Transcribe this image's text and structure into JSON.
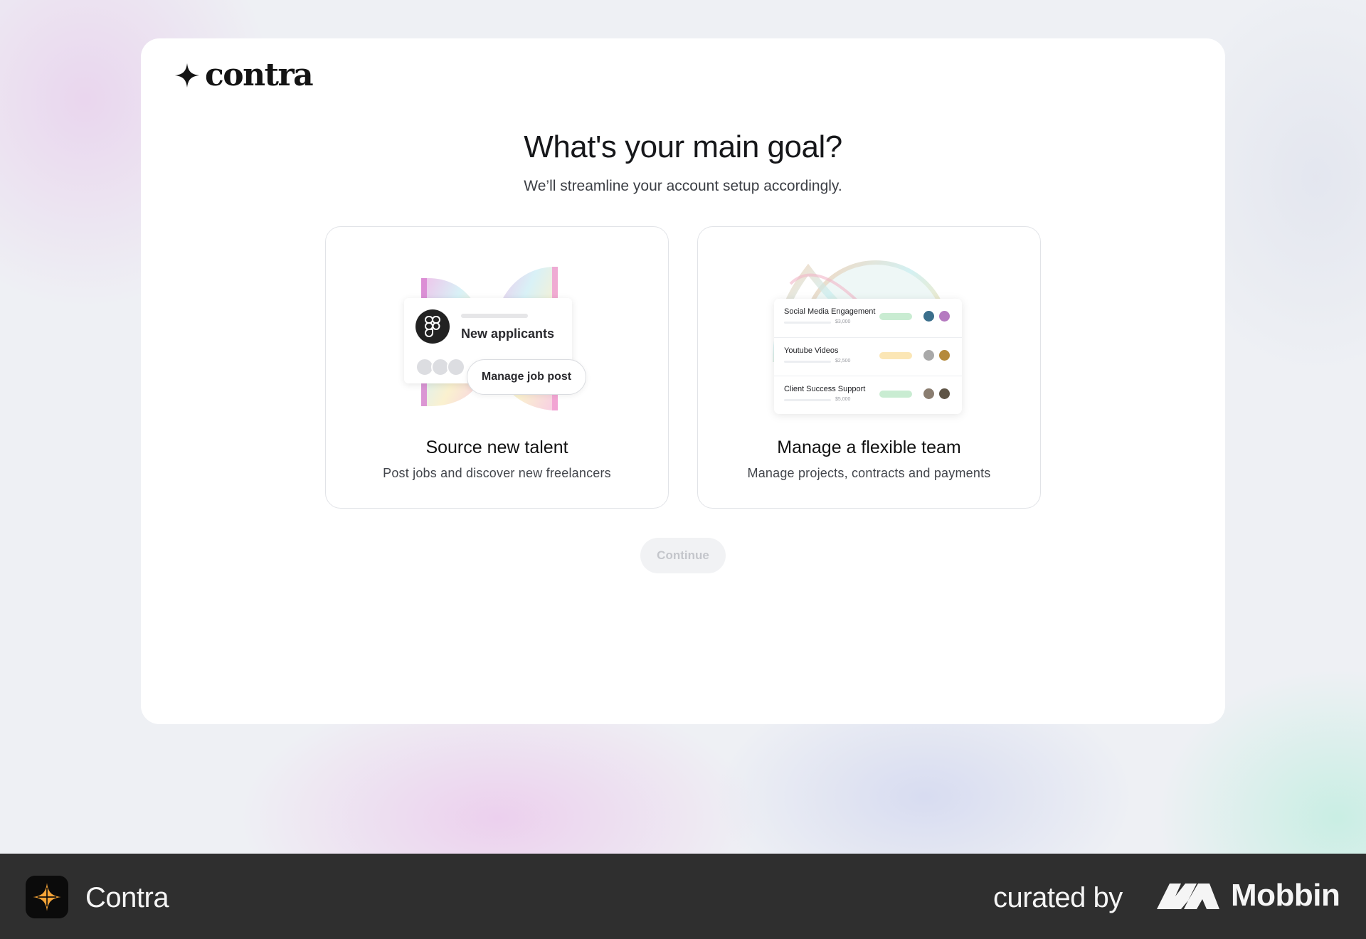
{
  "brand": {
    "logo_text": "contra",
    "logo_icon": "sparkle-star-icon"
  },
  "page": {
    "title": "What's your main goal?",
    "subtitle": "We’ll streamline your account setup accordingly."
  },
  "options": [
    {
      "title": "Source new talent",
      "description": "Post jobs and discover new freelancers",
      "illustration": {
        "card_label": "New applicants",
        "button_label": "Manage job post",
        "icon": "figma-icon"
      }
    },
    {
      "title": "Manage a flexible team",
      "description": "Manage projects, contracts and payments",
      "illustration": {
        "rows": [
          {
            "name": "Social Media Engagement",
            "amount": "$3,000",
            "bar_color": "#c9ecd2"
          },
          {
            "name": "Youtube Videos",
            "amount": "$2,500",
            "bar_color": "#fbe6b5"
          },
          {
            "name": "Client Success Support",
            "amount": "$5,000",
            "bar_color": "#c9ecd2"
          }
        ]
      }
    }
  ],
  "actions": {
    "continue_label": "Continue",
    "continue_enabled": false
  },
  "footer": {
    "app_name": "Contra",
    "curated_by": "curated by",
    "curator": "Mobbin"
  },
  "colors": {
    "background": "#eef0f4",
    "card": "#ffffff",
    "text_primary": "#16171a",
    "footer_bg": "#2f2f2f",
    "continue_disabled_bg": "#f1f2f4",
    "continue_disabled_text": "#c4c6cb",
    "accent_orange": "#f6a437"
  }
}
